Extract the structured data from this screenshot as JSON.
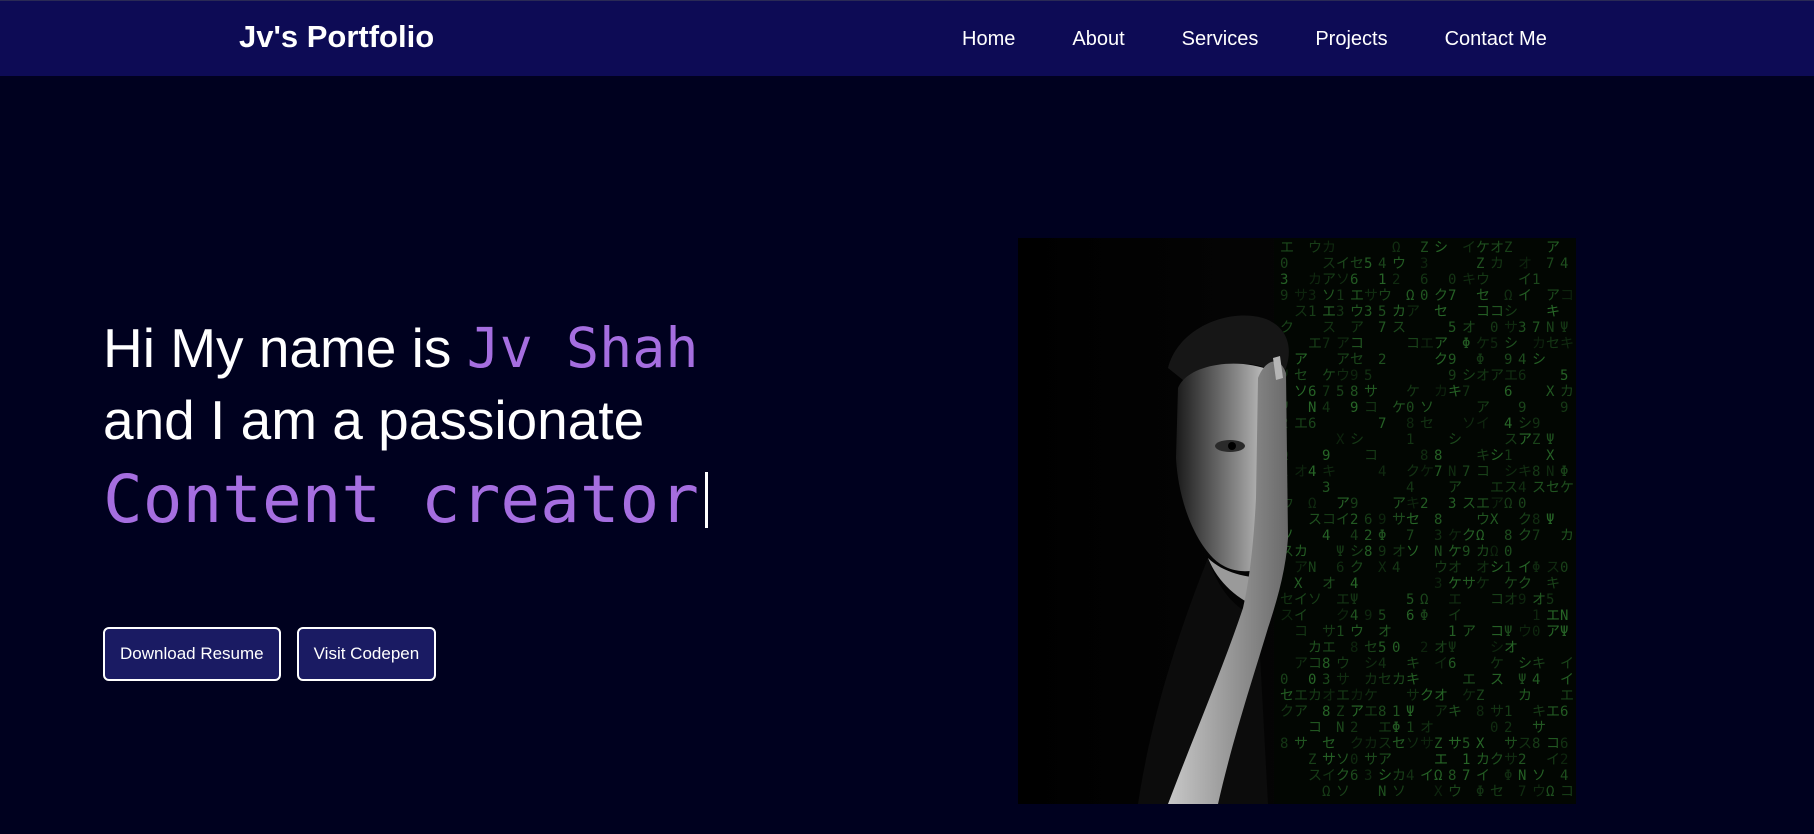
{
  "header": {
    "brand": "Jv's Portfolio",
    "nav": {
      "home": "Home",
      "about": "About",
      "services": "Services",
      "projects": "Projects",
      "contact": "Contact Me"
    }
  },
  "hero": {
    "intro_prefix": "Hi My name is ",
    "name": "Jv Shah",
    "intro_line2": "and I am a passionate",
    "role": "Content creator"
  },
  "actions": {
    "resume_label": "Download Resume",
    "codepen_label": "Visit Codepen"
  },
  "colors": {
    "nav_background": "#0d0b55",
    "page_background": "#00011f",
    "accent": "#a56ee0",
    "button_background": "#1a1b63",
    "matrix_green": "#2f8a2f"
  },
  "portrait_image": {
    "icon": "person-portrait-matrix-image"
  }
}
